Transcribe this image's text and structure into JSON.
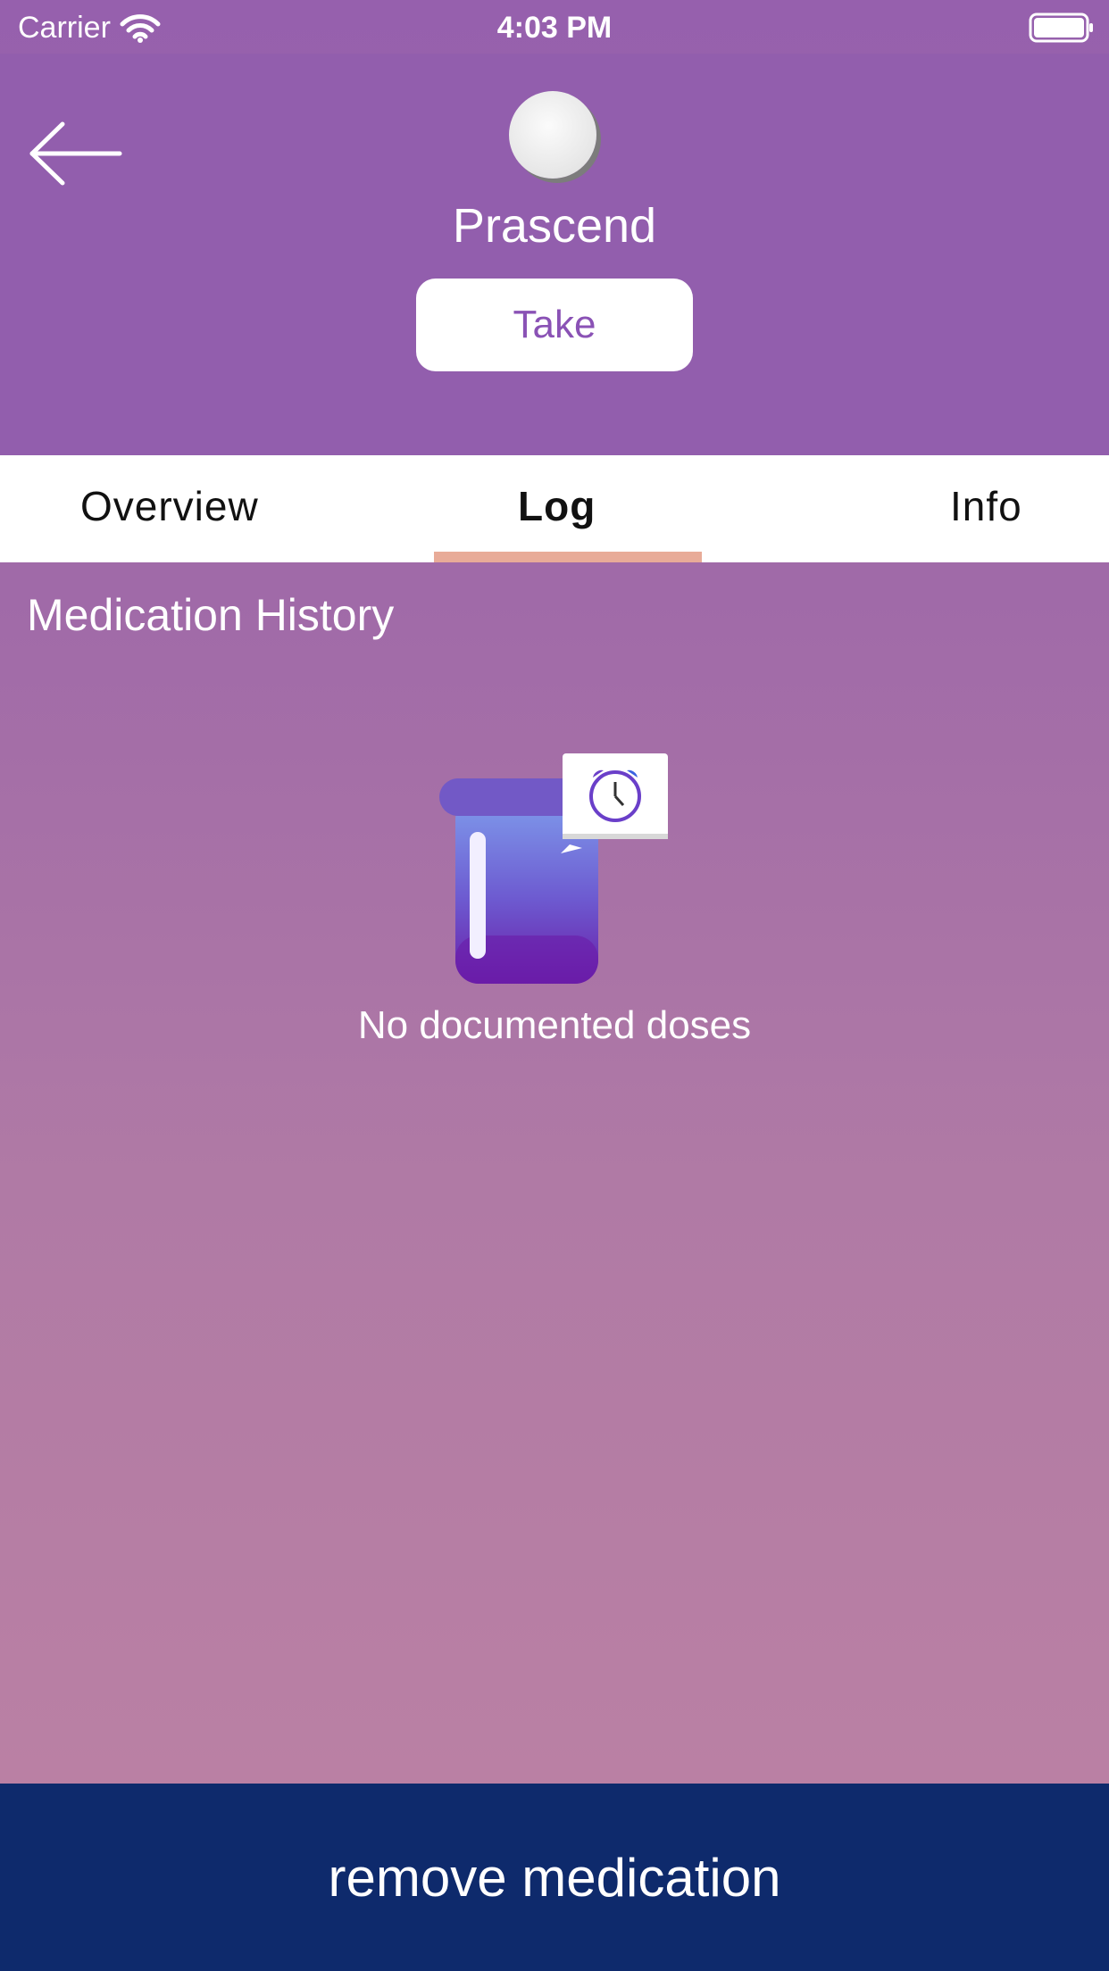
{
  "status_bar": {
    "carrier": "Carrier",
    "time": "4:03 PM"
  },
  "header": {
    "medication_name": "Prascend",
    "take_label": "Take",
    "back_icon": "arrow-left-icon",
    "pill_icon": "pill-icon"
  },
  "tabs": [
    {
      "label": "Overview",
      "selected": false
    },
    {
      "label": "Log",
      "selected": true
    },
    {
      "label": "Info",
      "selected": false
    }
  ],
  "log": {
    "section_title": "Medication History",
    "empty_message": "No documented doses",
    "empty_icon": "pill-bottle-alarm-icon"
  },
  "footer": {
    "remove_label": "remove medication"
  },
  "colors": {
    "header": "#925ead",
    "tab_indicator": "#e8ab98",
    "footer": "#0e2a6c",
    "take_text": "#8a52b5"
  }
}
